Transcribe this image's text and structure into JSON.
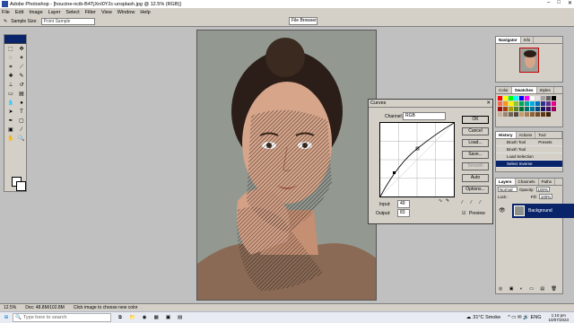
{
  "window": {
    "title": "Adobe Photoshop - [houcine-ncib-B4TjXnI0Y2c-unsplash.jpg @ 12.5% (RGB)]"
  },
  "menu": [
    "File",
    "Edit",
    "Image",
    "Layer",
    "Select",
    "Filter",
    "View",
    "Window",
    "Help"
  ],
  "options_bar": {
    "sample_size_label": "Sample Size:",
    "sample_size_value": "Point Sample"
  },
  "file_browser_tab": "File Browser",
  "curves": {
    "title": "Curves",
    "channel_label": "Channel:",
    "channel_value": "RGB",
    "input_label": "Input:",
    "input_value": "49",
    "output_label": "Output:",
    "output_value": "83",
    "buttons": [
      "OK",
      "Cancel",
      "Load...",
      "Save...",
      "Smooth",
      "Auto",
      "Options..."
    ],
    "preview_label": "Preview"
  },
  "navigator": {
    "tabs": [
      "Navigator",
      "Info"
    ]
  },
  "color_panel": {
    "tabs": [
      "Color",
      "Swatches",
      "Styles"
    ]
  },
  "history": {
    "tabs": [
      "History",
      "Actions",
      "Tool Presets"
    ],
    "items": [
      "Brush Tool",
      "Brush Tool",
      "Load Selection",
      "Select Inverse"
    ]
  },
  "layers": {
    "tabs": [
      "Layers",
      "Channels",
      "Paths"
    ],
    "mode": "Normal",
    "opacity_label": "Opacity:",
    "opacity_value": "100%",
    "lock_label": "Lock:",
    "fill_label": "Fill:",
    "fill_value": "100%",
    "layer_name": "Background"
  },
  "status": {
    "zoom": "12.5%",
    "doc": "Doc: 48.8M/102.8M",
    "hint": "Click image to choose new color"
  },
  "taskbar": {
    "search_placeholder": "Type here to search",
    "weather": "31°C Smoke",
    "time": "1:10 pm",
    "date": "10/07/2023"
  }
}
